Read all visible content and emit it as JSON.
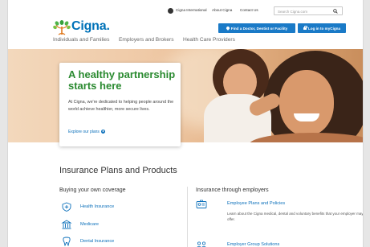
{
  "utility": {
    "international": "Cigna International",
    "about": "About Cigna",
    "contact": "Contact Us",
    "search_placeholder": "Search Cigna.com"
  },
  "brand": {
    "logo_text": "Cigna.",
    "primary_blue": "#0072b8",
    "accent_green": "#2a8a30",
    "button_blue": "#1a7ac7"
  },
  "header": {
    "find_button": "Find a Doctor, Dentist or Facility",
    "login_button": "Log in to myCigna"
  },
  "nav": {
    "individuals": "Individuals and Families",
    "employers": "Employers and Brokers",
    "providers": "Health Care Providers"
  },
  "hero": {
    "title": "A healthy partnership starts here",
    "description": "At Cigna, we're dedicated to helping people around the world achieve healthier, more secure lives.",
    "link": "Explore our plans"
  },
  "plans": {
    "title": "Insurance Plans and Products",
    "left_heading": "Buying your own coverage",
    "right_heading": "Insurance through employers",
    "own_coverage": [
      {
        "label": "Health Insurance",
        "icon": "shield-health-icon"
      },
      {
        "label": "Medicare",
        "icon": "building-icon"
      },
      {
        "label": "Dental Insurance",
        "icon": "tooth-icon"
      }
    ],
    "employer": [
      {
        "label": "Employee Plans and Policies",
        "sub": "Learn about the Cigna medical, dental and voluntary benefits that your employer may offer.",
        "icon": "id-card-icon"
      },
      {
        "label": "Employer Group Solutions",
        "sub": "",
        "icon": "group-icon"
      }
    ]
  }
}
